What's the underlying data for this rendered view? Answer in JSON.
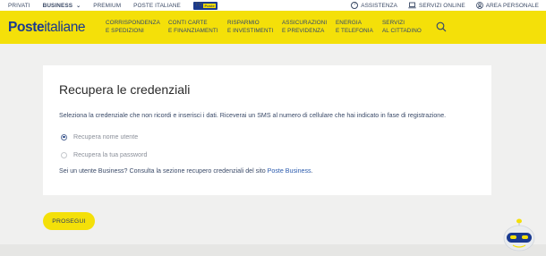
{
  "topbar": {
    "left": [
      "PRIVATI",
      "BUSINESS",
      "PREMIUM",
      "POSTE ITALIANE"
    ],
    "tg_logo": {
      "main": "TG",
      "sub": "Poste"
    },
    "right": [
      "ASSISTENZA",
      "SERVIZI ONLINE",
      "AREA PERSONALE"
    ]
  },
  "header": {
    "logo_bold": "Poste",
    "logo_thin": "italiane",
    "nav": [
      {
        "line1": "CORRISPONDENZA",
        "line2": "E SPEDIZIONI"
      },
      {
        "line1": "CONTI CARTE",
        "line2": "E FINANZIAMENTI"
      },
      {
        "line1": "RISPARMIO",
        "line2": "E INVESTIMENTI"
      },
      {
        "line1": "ASSICURAZIONI",
        "line2": "E PREVIDENZA"
      },
      {
        "line1": "ENERGIA",
        "line2": "E TELEFONIA"
      },
      {
        "line1": "SERVIZI",
        "line2": "AL CITTADINO"
      }
    ]
  },
  "card": {
    "title": "Recupera le credenziali",
    "description": "Seleziona la credenziale che non ricordi e inserisci i dati. Riceverai un SMS al numero di cellulare che hai indicato in fase di registrazione.",
    "options": [
      {
        "label": "Recupera nome utente",
        "selected": true
      },
      {
        "label": "Recupera la tua password",
        "selected": false
      }
    ],
    "business_text": "Sei un utente Business? Consulta la sezione recupero credenziali del sito ",
    "business_link": "Poste Business",
    "business_end": "."
  },
  "button": {
    "label": "PROSEGUI"
  },
  "colors": {
    "brand_yellow": "#f4e009",
    "brand_blue": "#1a3a8f",
    "link_blue": "#2a5aad"
  }
}
